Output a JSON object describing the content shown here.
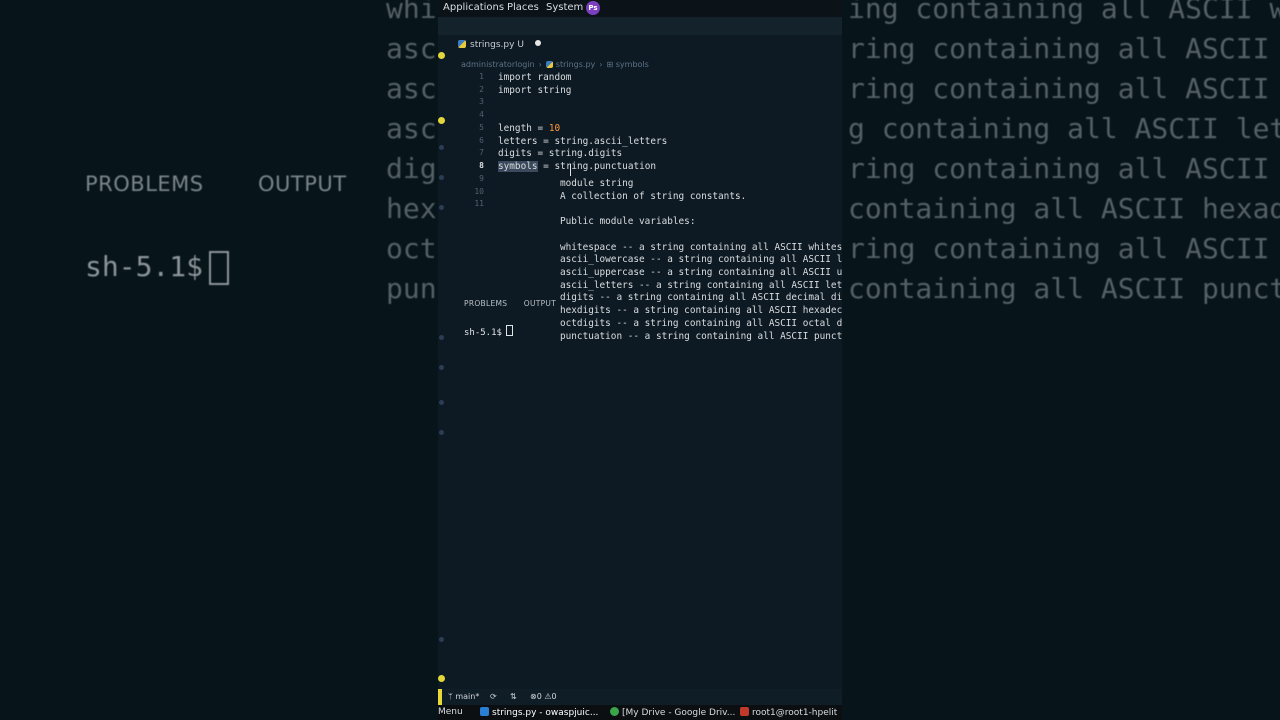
{
  "background_echo": {
    "left_tabs": [
      "PROBLEMS",
      "OUTPUT"
    ],
    "left_prompt": "sh-5.1$",
    "right_lines": [
      "ing containing all ASCII whites",
      "ring containing all ASCII lo",
      "ring containing all ASCII up",
      "g containing all ASCII lett",
      "ring containing all ASCII decimal di",
      "containing all ASCII hexadeci",
      "ring containing all ASCII octal di",
      "containing all ASCII punctu"
    ],
    "left_fragments": [
      "whi",
      "asc",
      "asc",
      "asc",
      "dig",
      "hex",
      "oct",
      "pun"
    ]
  },
  "topbar": {
    "applications": "Applications",
    "places": "Places",
    "system": "System"
  },
  "tab": {
    "filename": "strings.py",
    "status": "U"
  },
  "breadcrumb": {
    "folder": "administratorlogin",
    "file": "strings.py",
    "symbol": "symbols"
  },
  "line_numbers": [
    "1",
    "2",
    "3",
    "4",
    "5",
    "6",
    "7",
    "8",
    "9",
    "10",
    "11"
  ],
  "code": {
    "l1": "import random",
    "l2": "import string",
    "l5_a": "length = ",
    "l5_num": "10",
    "l6": "letters = string.ascii_letters",
    "l7": "digits = string.digits",
    "l8_sel": "symbols",
    "l8_rest": " = string.punctuation"
  },
  "hover": {
    "lines": [
      "module string",
      "A collection of string constants.",
      "",
      "Public module variables:",
      "",
      "whitespace -- a string containing all ASCII whitespace",
      "ascii_lowercase -- a string containing all ASCII lowercase",
      "ascii_uppercase -- a string containing all ASCII uppercase",
      "ascii_letters -- a string containing all ASCII letters",
      "digits -- a string containing all ASCII decimal digits",
      "hexdigits -- a string containing all ASCII hexadecimal",
      "octdigits -- a string containing all ASCII octal digits",
      "punctuation -- a string containing all ASCII punctuation"
    ]
  },
  "panel": {
    "problems": "PROBLEMS",
    "output": "OUTPUT",
    "prompt": "sh-5.1$"
  },
  "statusbar": {
    "branch": "main*",
    "errors": "0",
    "warnings": "0"
  },
  "taskbar": {
    "menu": "Menu",
    "vscode": "strings.py - owaspjuic...",
    "chrome": "[My Drive - Google Driv...",
    "terminal": "root1@root1-hpelit"
  },
  "colors": {
    "editor_bg": "#0e1a23",
    "number": "#ff9a3c",
    "selection": "#3a4a5c",
    "accent_yellow": "#e8d83a"
  }
}
